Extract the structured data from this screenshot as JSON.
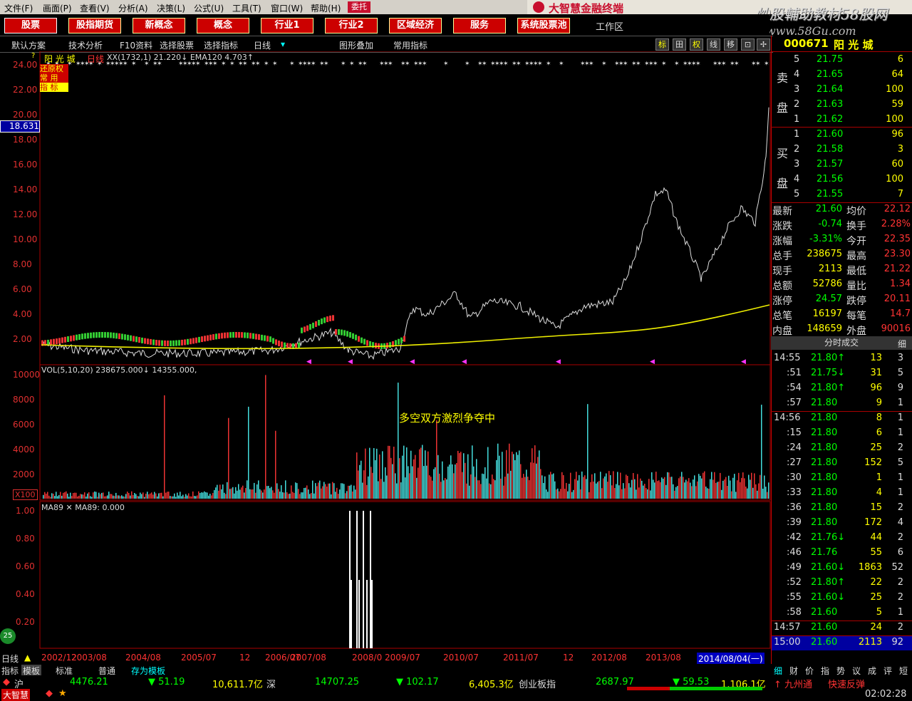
{
  "menu": [
    "文件(F)",
    "画面(P)",
    "查看(V)",
    "分析(A)",
    "决策(L)",
    "公式(U)",
    "工具(T)",
    "窗口(W)",
    "帮助(H)"
  ],
  "entrust_label": "委托",
  "brand": "大智慧金融终端",
  "watermark": {
    "line1": "炒股輔助教材58股网",
    "line2": "www.58Gu.com"
  },
  "categories": [
    "股票",
    "股指期货",
    "新概念",
    "概念",
    "行业1",
    "行业2",
    "区域经济",
    "服务",
    "系统股票池"
  ],
  "workarea": "工作区",
  "toolbar": {
    "items": [
      "默认方案",
      "技术分析",
      "F10资料",
      "选择股票",
      "选择指标",
      "日线",
      "图形叠加",
      "常用指标"
    ],
    "right_buttons": [
      "标",
      "田",
      "权",
      "线",
      "移",
      "⊡",
      "✢"
    ]
  },
  "chart": {
    "stock_name": "阳 光 城",
    "period": "日线",
    "indicator_line": "XX(1732,1) 21.220↓ EMA120  4.703↑",
    "side_labels": [
      "还原权",
      "常 用",
      "指 标"
    ],
    "price_marker": "18.631",
    "y_labels": [
      "24.00",
      "22.00",
      "20.00",
      "18.00",
      "16.00",
      "14.00",
      "12.00",
      "10.00",
      "8.00",
      "6.00",
      "4.00",
      "2.00"
    ],
    "vol_line": "VOL(5,10,20) 238675.000↓ 14355.000,",
    "vol_labels": [
      "10000",
      "8000",
      "6000",
      "4000",
      "2000"
    ],
    "vol_unit": "X100",
    "vol_annotation": "多空双方激烈争夺中",
    "ma_line": "MA89 ✕ MA89: 0.000",
    "ma_labels": [
      "1.00",
      "0.80",
      "0.60",
      "0.40",
      "0.20"
    ],
    "date_labels": [
      "2002/12",
      "2003/08",
      "2004/08",
      "2005/07",
      "12",
      "2006/07",
      "2007/08",
      "2008/0",
      "2009/07",
      "2010/07",
      "2011/07",
      "12",
      "2012/08",
      "2013/08"
    ],
    "date_current": "2014/08/04(一)",
    "bottom_left": "日线"
  },
  "quote": {
    "code": "000671",
    "name": "阳 光 城",
    "sell_label": [
      "卖",
      "盘"
    ],
    "buy_label": [
      "买",
      "盘"
    ],
    "sell": [
      {
        "n": "5",
        "p": "21.75",
        "v": "6"
      },
      {
        "n": "4",
        "p": "21.65",
        "v": "64"
      },
      {
        "n": "3",
        "p": "21.64",
        "v": "100"
      },
      {
        "n": "2",
        "p": "21.63",
        "v": "59"
      },
      {
        "n": "1",
        "p": "21.62",
        "v": "100"
      }
    ],
    "buy": [
      {
        "n": "1",
        "p": "21.60",
        "v": "96"
      },
      {
        "n": "2",
        "p": "21.58",
        "v": "3"
      },
      {
        "n": "3",
        "p": "21.57",
        "v": "60"
      },
      {
        "n": "4",
        "p": "21.56",
        "v": "100"
      },
      {
        "n": "5",
        "p": "21.55",
        "v": "7"
      }
    ],
    "stats": [
      {
        "l1": "最新",
        "v1": "21.60",
        "l2": "均价",
        "v2": "22.12"
      },
      {
        "l1": "涨跌",
        "v1": "-0.74",
        "l2": "换手",
        "v2": "2.28%"
      },
      {
        "l1": "涨幅",
        "v1": "-3.31%",
        "l2": "今开",
        "v2": "22.35"
      },
      {
        "l1": "总手",
        "v1": "238675",
        "l2": "最高",
        "v2": "23.30"
      },
      {
        "l1": "现手",
        "v1": "2113",
        "l2": "最低",
        "v2": "21.22"
      },
      {
        "l1": "总额",
        "v1": "52786",
        "l2": "量比",
        "v2": "1.34"
      },
      {
        "l1": "涨停",
        "v1": "24.57",
        "l2": "跌停",
        "v2": "20.11"
      },
      {
        "l1": "总笔",
        "v1": "16197",
        "l2": "每笔",
        "v2": "14.7"
      },
      {
        "l1": "内盘",
        "v1": "148659",
        "l2": "外盘",
        "v2": "90016"
      }
    ],
    "ticks_title": "分时成交",
    "ticks": [
      {
        "t": "14:55",
        "p": "21.80↑",
        "v": "13",
        "c": "3"
      },
      {
        "t": ":51",
        "p": "21.75↓",
        "v": "31",
        "c": "5"
      },
      {
        "t": ":54",
        "p": "21.80↑",
        "v": "96",
        "c": "9"
      },
      {
        "t": ":57",
        "p": "21.80",
        "v": "9",
        "c": "1"
      },
      {
        "t": "14:56",
        "p": "21.80",
        "v": "8",
        "c": "1"
      },
      {
        "t": ":15",
        "p": "21.80",
        "v": "6",
        "c": "1"
      },
      {
        "t": ":24",
        "p": "21.80",
        "v": "25",
        "c": "2"
      },
      {
        "t": ":27",
        "p": "21.80",
        "v": "152",
        "c": "5"
      },
      {
        "t": ":30",
        "p": "21.80",
        "v": "1",
        "c": "1"
      },
      {
        "t": ":33",
        "p": "21.80",
        "v": "4",
        "c": "1"
      },
      {
        "t": ":36",
        "p": "21.80",
        "v": "15",
        "c": "2"
      },
      {
        "t": ":39",
        "p": "21.80",
        "v": "172",
        "c": "4"
      },
      {
        "t": ":42",
        "p": "21.76↓",
        "v": "44",
        "c": "2"
      },
      {
        "t": ":46",
        "p": "21.76",
        "v": "55",
        "c": "6"
      },
      {
        "t": ":49",
        "p": "21.60↓",
        "v": "1863",
        "c": "52"
      },
      {
        "t": ":52",
        "p": "21.80↑",
        "v": "22",
        "c": "2"
      },
      {
        "t": ":55",
        "p": "21.60↓",
        "v": "25",
        "c": "2"
      },
      {
        "t": ":58",
        "p": "21.60",
        "v": "5",
        "c": "1"
      },
      {
        "t": "14:57",
        "p": "21.60",
        "v": "24",
        "c": "2"
      },
      {
        "t": "15:00",
        "p": "21.60",
        "v": "2113",
        "c": "92"
      }
    ],
    "bottom_tabs": [
      "细",
      "财",
      "价",
      "指",
      "势",
      "议",
      "成",
      "评",
      "短"
    ]
  },
  "tabs": [
    "指标",
    "模板",
    "标准",
    "普通",
    "存为模板"
  ],
  "status": {
    "sh_label": "沪",
    "sh_index": "4476.21",
    "sh_change": "▼ 51.19",
    "sh_amount": "10,611.7亿",
    "sz_label": "深",
    "sz_index": "14707.25",
    "sz_change": "▼ 102.17",
    "sz_amount": "6,405.3亿",
    "cy_label": "创业板指",
    "cy_index": "2687.97",
    "cy_change": "▼ 59.53",
    "cy_amount": "1,106.1亿",
    "news1": "↑ 九州通",
    "news2": "快速反弹",
    "logo": "大智慧",
    "time": "02:02:28"
  }
}
